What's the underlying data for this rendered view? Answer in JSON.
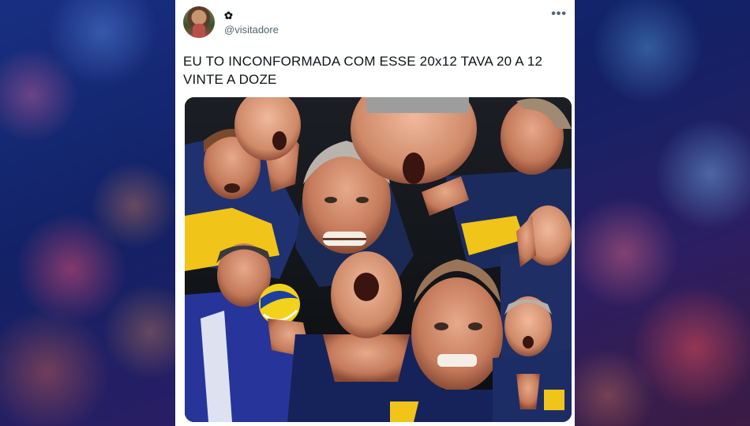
{
  "tweet": {
    "display_name": "✿",
    "handle": "@visitadore",
    "more_icon": "ellipsis-icon",
    "text": "EU TO INCONFORMADA COM ESSE 20x12 TAVA 20 A 12 VINTE A DOZE",
    "media": {
      "description_icon": "photo-collage"
    }
  },
  "colors": {
    "text_primary": "#0f1419",
    "text_secondary": "#536471",
    "card_bg": "#ffffff"
  }
}
